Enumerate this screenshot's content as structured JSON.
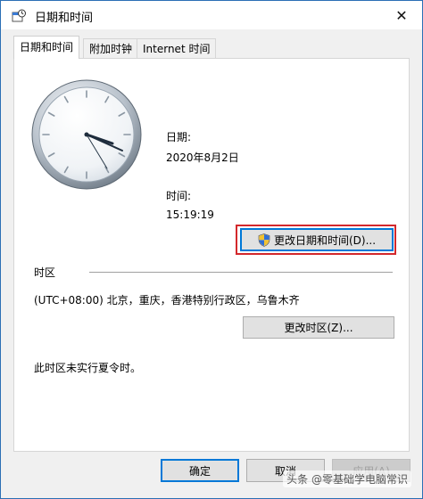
{
  "window": {
    "title": "日期和时间",
    "close_glyph": "✕"
  },
  "tabs": [
    {
      "label": "日期和时间",
      "active": true
    },
    {
      "label": "附加时钟",
      "active": false
    },
    {
      "label": "Internet 时间",
      "active": false
    }
  ],
  "datetime": {
    "date_label": "日期:",
    "date_value": "2020年8月2日",
    "time_label": "时间:",
    "time_value": "15:19:19",
    "change_button_label": "更改日期和时间(D)..."
  },
  "timezone": {
    "section_label": "时区",
    "value": "(UTC+08:00) 北京，重庆，香港特别行政区，乌鲁木齐",
    "change_button_label": "更改时区(Z)...",
    "dst_note": "此时区未实行夏令时。"
  },
  "footer": {
    "ok_label": "确定",
    "cancel_label": "取消",
    "apply_label": "应用(A)",
    "apply_disabled": true
  },
  "watermark": "头条 @零基础学电脑常识",
  "colors": {
    "accent": "#0078d7",
    "highlight": "#d3282c",
    "dialog_bg": "#f0f0f0"
  }
}
